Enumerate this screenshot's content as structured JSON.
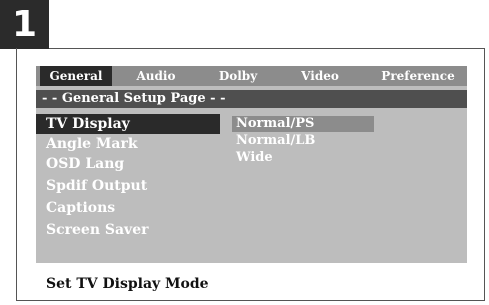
{
  "step_number": "1",
  "tabs": [
    "General",
    "Audio",
    "Dolby",
    "Video",
    "Preference"
  ],
  "active_tab": "General",
  "page_heading": "- - General Setup Page - -",
  "menu": {
    "items": [
      "TV Display",
      "Angle Mark",
      "OSD Lang",
      "Spdif Output",
      "Captions",
      "Screen Saver"
    ],
    "selected": "TV Display"
  },
  "options": {
    "items": [
      "Normal/PS",
      "Normal/LB",
      "Wide"
    ],
    "highlighted": "Normal/PS"
  },
  "status_text": "Set TV Display Mode"
}
